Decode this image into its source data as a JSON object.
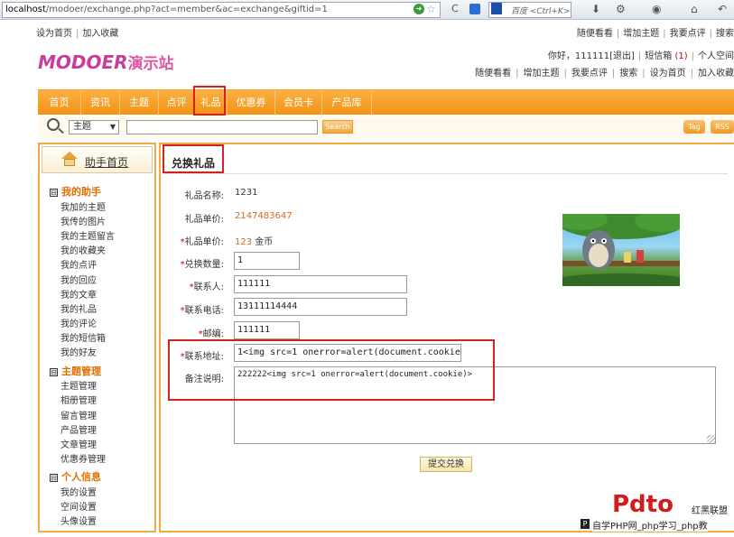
{
  "browser": {
    "url_host": "localhost",
    "url_path": "/modoer/exchange.php?act=member&ac=exchange&giftid=1",
    "search_placeholder": "百度 <Ctrl+K>"
  },
  "top_links": {
    "left": [
      "设为首页",
      "加入收藏"
    ],
    "right": [
      "随便看看",
      "增加主题",
      "我要点评",
      "搜索"
    ]
  },
  "logo": {
    "latin": "MODOER",
    "chinese": "演示站"
  },
  "user_line": {
    "greeting": "你好，",
    "username": "111111",
    "logout": "[退出]",
    "inbox": "短信箱",
    "inbox_count": "(1)",
    "space": "个人空间"
  },
  "quick_links": [
    "随便看看",
    "增加主题",
    "我要点评",
    "搜索",
    "设为首页",
    "加入收藏"
  ],
  "nav": {
    "items": [
      "首页",
      "资讯",
      "主题",
      "点评",
      "礼品",
      "优惠券",
      "会员卡",
      "产品库"
    ]
  },
  "search": {
    "select_value": "主题",
    "button_label": "Search",
    "tag_label": "Tag",
    "rss_label": "RSS"
  },
  "sidebar": {
    "home_label": "助手首页",
    "group_toggle": "⊟",
    "groups": [
      {
        "title": "我的助手",
        "items": [
          "我加的主题",
          "我传的图片",
          "我的主题留言",
          "我的收藏夹",
          "我的点评",
          "我的回应",
          "我的文章",
          "我的礼品",
          "我的评论",
          "我的短信箱",
          "我的好友"
        ]
      },
      {
        "title": "主题管理",
        "items": [
          "主题管理",
          "相册管理",
          "留言管理",
          "产品管理",
          "文章管理",
          "优惠券管理"
        ]
      },
      {
        "title": "个人信息",
        "items": [
          "我的设置",
          "空间设置",
          "头像设置"
        ]
      }
    ]
  },
  "main": {
    "title": "兑换礼品",
    "fields": {
      "gift_name_label": "礼品名称:",
      "gift_name": "1231",
      "price_label": "礼品单价:",
      "price": "2147483647",
      "price2_label": "礼品单价:",
      "price2": "123",
      "price2_unit": "金币",
      "qty_label": "兑换数量:",
      "qty": "1",
      "contact_label": "联系人:",
      "contact": "111111",
      "phone_label": "联系电话:",
      "phone": "13111114444",
      "zip_label": "邮编:",
      "zip": "111111",
      "address_label": "联系地址:",
      "address": "1<img src=1 onerror=alert(document.cookie",
      "note_label": "备注说明:",
      "note": "222222<img src=1 onerror=alert(document.cookie)>"
    },
    "submit_label": "提交兑换"
  },
  "watermark": {
    "logo": "Pdto",
    "brand": "红黑联盟",
    "sub": "自学PHP网_php学习_php教"
  }
}
